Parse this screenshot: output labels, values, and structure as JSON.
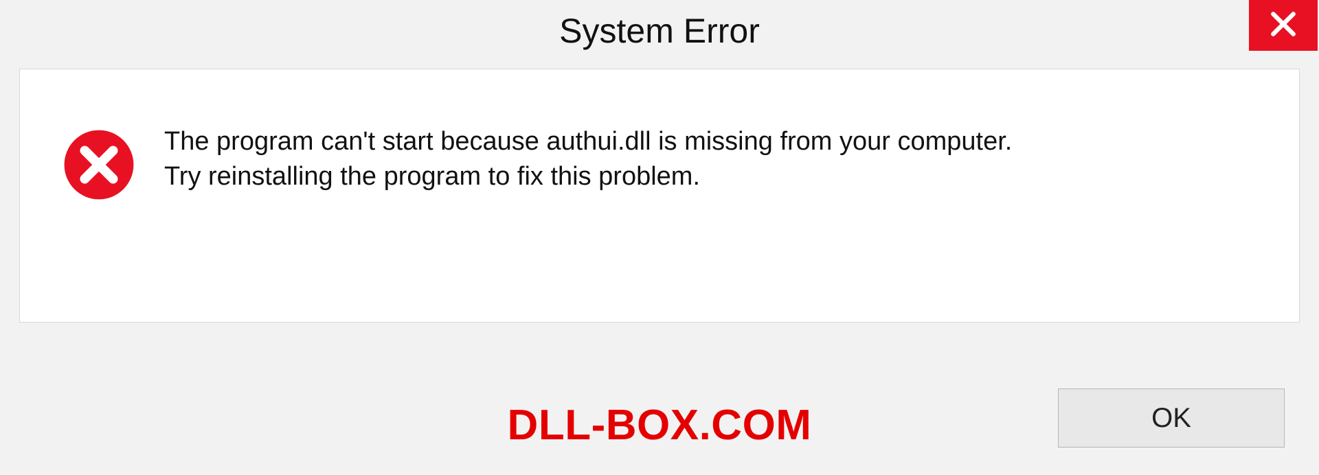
{
  "titlebar": {
    "title": "System Error"
  },
  "message": {
    "line1": "The program can't start because authui.dll is missing from your computer.",
    "line2": "Try reinstalling the program to fix this problem."
  },
  "footer": {
    "watermark": "DLL-BOX.COM",
    "ok_label": "OK"
  },
  "colors": {
    "close_bg": "#e81123",
    "error_red": "#e40000"
  }
}
